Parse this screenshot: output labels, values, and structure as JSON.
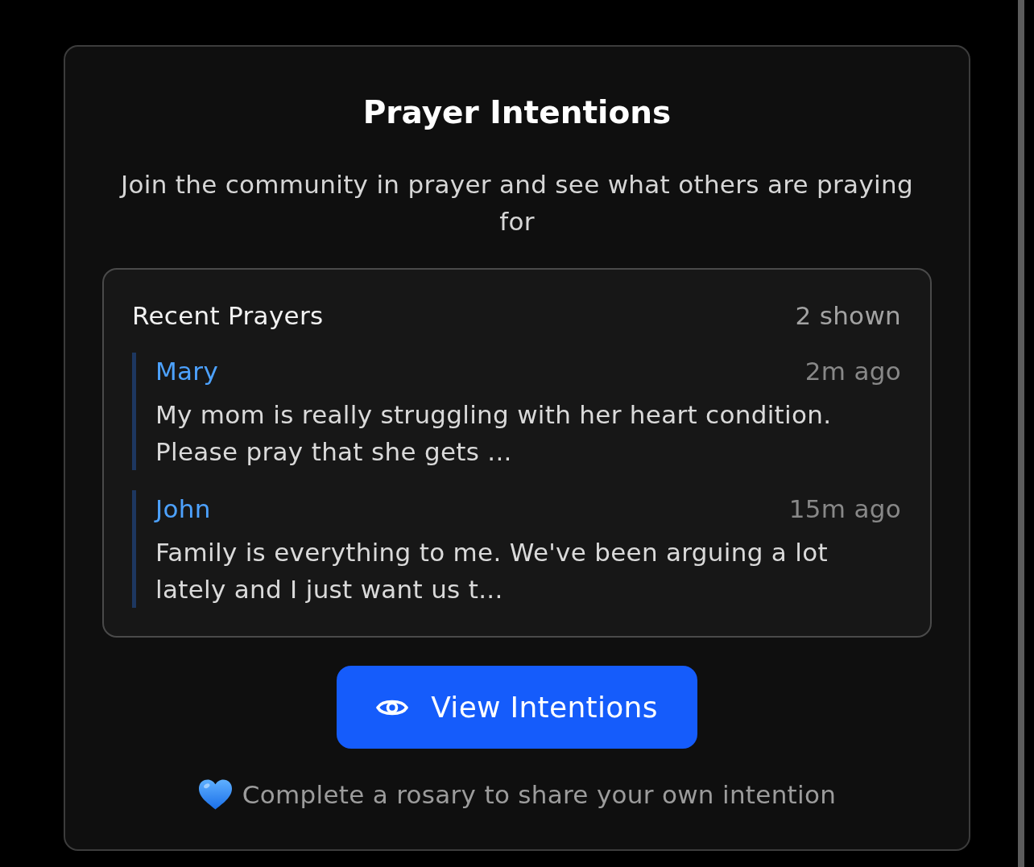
{
  "card": {
    "title": "Prayer Intentions",
    "subtitle": "Join the community in prayer and see what others are praying for"
  },
  "recent_prayers": {
    "heading": "Recent Prayers",
    "count": "2 shown",
    "prayers": [
      {
        "name": "Mary",
        "time": "2m ago",
        "text": "My mom is really struggling with her heart condition. Please pray that she gets ..."
      },
      {
        "name": "John",
        "time": "15m ago",
        "text": "Family is everything to me. We've been arguing a lot lately and I just want us t..."
      }
    ]
  },
  "button": {
    "label": "View Intentions"
  },
  "footer": {
    "text": "Complete a rosary to share your own intention"
  }
}
